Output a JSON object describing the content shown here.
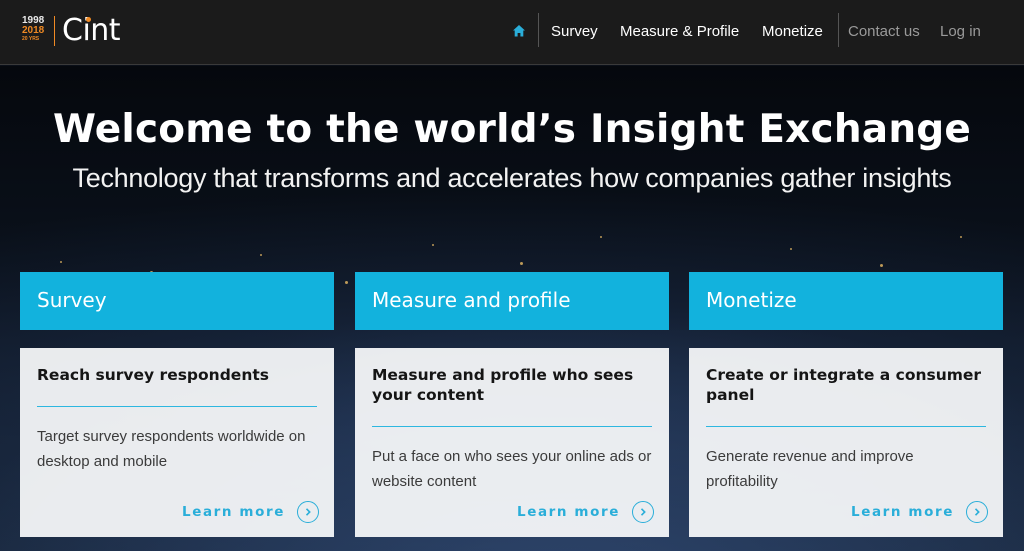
{
  "header": {
    "logo": {
      "years_top": "1998",
      "years_bottom": "2018",
      "years_tiny": "20 YRS",
      "wordmark": "Cint"
    },
    "nav": {
      "home_icon": "home-icon",
      "survey": "Survey",
      "measure_profile": "Measure & Profile",
      "monetize": "Monetize",
      "contact": "Contact us",
      "login": "Log in"
    }
  },
  "hero": {
    "title": "Welcome to the world’s Insight Exchange",
    "subtitle": "Technology that transforms and accelerates how companies gather insights"
  },
  "cards": [
    {
      "header": "Survey",
      "title": "Reach survey respondents",
      "text": "Target survey respondents worldwide on desktop and mobile",
      "cta": "Learn more"
    },
    {
      "header": "Measure and profile",
      "title": "Measure and profile who sees your content",
      "text": "Put a face on who sees your online ads or website content",
      "cta": "Learn more"
    },
    {
      "header": "Monetize",
      "title": "Create or integrate a consumer panel",
      "text": "Generate revenue and improve profitability",
      "cta": "Learn more"
    }
  ],
  "colors": {
    "accent": "#12b2dd",
    "brand_orange": "#f08a24",
    "header_bg": "#1b1b1b"
  }
}
